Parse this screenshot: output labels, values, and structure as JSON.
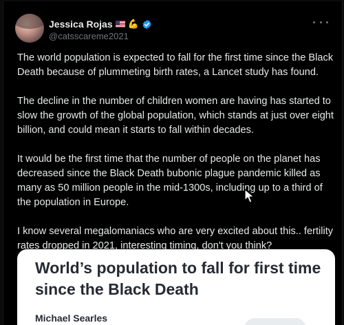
{
  "author": {
    "display_name": "Jessica Rojas",
    "handle": "@catsscareme2021",
    "badges": [
      "us-flag-icon",
      "flexed-biceps-icon",
      "verified-icon"
    ],
    "verified_color": "#1d9bf0"
  },
  "tweet": {
    "paragraphs": [
      "The world population is expected to fall for the first time since the Black Death because of plummeting birth rates, a Lancet study has found.",
      "The decline in the number of children women are having has started to slow the growth of the global population, which stands at just over eight billion, and could mean it starts to fall within decades.",
      "It would be the first time that the number of people on the planet has decreased since the Black Death bubonic plague pandemic killed as many as 50 million people in the mid-1300s, including up to a third of the population in Europe.",
      "I know several megalomaniacs who are very excited about this.. fertility rates dropped in 2021, interesting timing,  don't you think?"
    ]
  },
  "link_card": {
    "headline": "World’s population to fall for first time since the Black Death",
    "author": "Michael Searles"
  },
  "colors": {
    "background": "#000000",
    "text": "#e7e9ea",
    "secondary_text": "#71767b",
    "card_background": "#ffffff",
    "card_text": "#262a33"
  }
}
